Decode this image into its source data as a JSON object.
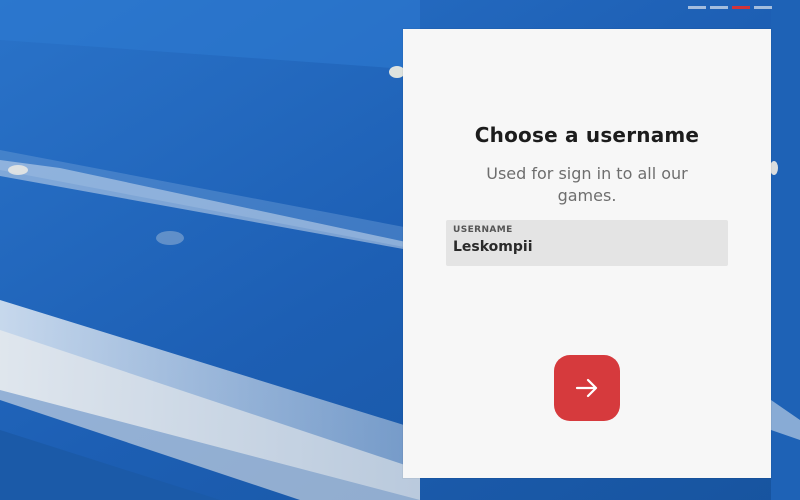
{
  "progress": {
    "total_steps": 4,
    "current_step": 3
  },
  "colors": {
    "background_blue": "#1f63b8",
    "card": "#f7f7f7",
    "accent_red": "#d63a3d",
    "field_bg": "#e4e4e4"
  },
  "card": {
    "title": "Choose a username",
    "subtitle": "Used for sign in to all our games."
  },
  "username_field": {
    "label": "USERNAME",
    "value": "Leskompii"
  },
  "next_button": {
    "icon": "arrow-right-icon"
  }
}
